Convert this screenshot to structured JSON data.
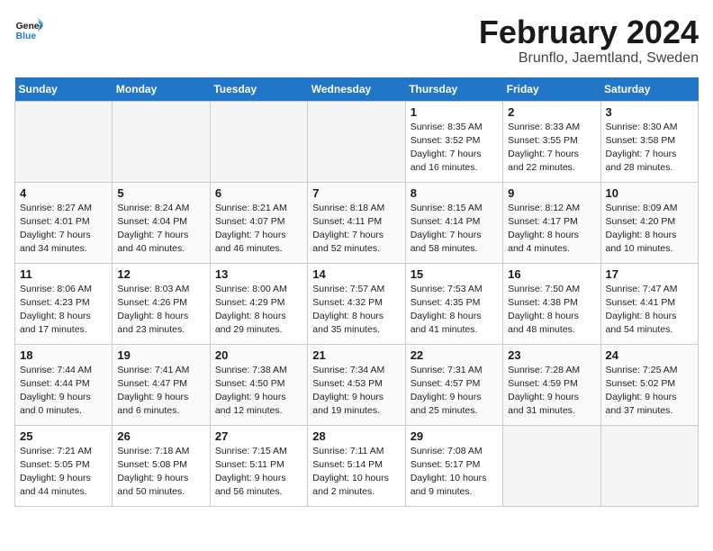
{
  "header": {
    "logo_general": "General",
    "logo_blue": "Blue",
    "month_title": "February 2024",
    "location": "Brunflo, Jaemtland, Sweden"
  },
  "days_of_week": [
    "Sunday",
    "Monday",
    "Tuesday",
    "Wednesday",
    "Thursday",
    "Friday",
    "Saturday"
  ],
  "weeks": [
    [
      {
        "day": "",
        "info": ""
      },
      {
        "day": "",
        "info": ""
      },
      {
        "day": "",
        "info": ""
      },
      {
        "day": "",
        "info": ""
      },
      {
        "day": "1",
        "info": "Sunrise: 8:35 AM\nSunset: 3:52 PM\nDaylight: 7 hours\nand 16 minutes."
      },
      {
        "day": "2",
        "info": "Sunrise: 8:33 AM\nSunset: 3:55 PM\nDaylight: 7 hours\nand 22 minutes."
      },
      {
        "day": "3",
        "info": "Sunrise: 8:30 AM\nSunset: 3:58 PM\nDaylight: 7 hours\nand 28 minutes."
      }
    ],
    [
      {
        "day": "4",
        "info": "Sunrise: 8:27 AM\nSunset: 4:01 PM\nDaylight: 7 hours\nand 34 minutes."
      },
      {
        "day": "5",
        "info": "Sunrise: 8:24 AM\nSunset: 4:04 PM\nDaylight: 7 hours\nand 40 minutes."
      },
      {
        "day": "6",
        "info": "Sunrise: 8:21 AM\nSunset: 4:07 PM\nDaylight: 7 hours\nand 46 minutes."
      },
      {
        "day": "7",
        "info": "Sunrise: 8:18 AM\nSunset: 4:11 PM\nDaylight: 7 hours\nand 52 minutes."
      },
      {
        "day": "8",
        "info": "Sunrise: 8:15 AM\nSunset: 4:14 PM\nDaylight: 7 hours\nand 58 minutes."
      },
      {
        "day": "9",
        "info": "Sunrise: 8:12 AM\nSunset: 4:17 PM\nDaylight: 8 hours\nand 4 minutes."
      },
      {
        "day": "10",
        "info": "Sunrise: 8:09 AM\nSunset: 4:20 PM\nDaylight: 8 hours\nand 10 minutes."
      }
    ],
    [
      {
        "day": "11",
        "info": "Sunrise: 8:06 AM\nSunset: 4:23 PM\nDaylight: 8 hours\nand 17 minutes."
      },
      {
        "day": "12",
        "info": "Sunrise: 8:03 AM\nSunset: 4:26 PM\nDaylight: 8 hours\nand 23 minutes."
      },
      {
        "day": "13",
        "info": "Sunrise: 8:00 AM\nSunset: 4:29 PM\nDaylight: 8 hours\nand 29 minutes."
      },
      {
        "day": "14",
        "info": "Sunrise: 7:57 AM\nSunset: 4:32 PM\nDaylight: 8 hours\nand 35 minutes."
      },
      {
        "day": "15",
        "info": "Sunrise: 7:53 AM\nSunset: 4:35 PM\nDaylight: 8 hours\nand 41 minutes."
      },
      {
        "day": "16",
        "info": "Sunrise: 7:50 AM\nSunset: 4:38 PM\nDaylight: 8 hours\nand 48 minutes."
      },
      {
        "day": "17",
        "info": "Sunrise: 7:47 AM\nSunset: 4:41 PM\nDaylight: 8 hours\nand 54 minutes."
      }
    ],
    [
      {
        "day": "18",
        "info": "Sunrise: 7:44 AM\nSunset: 4:44 PM\nDaylight: 9 hours\nand 0 minutes."
      },
      {
        "day": "19",
        "info": "Sunrise: 7:41 AM\nSunset: 4:47 PM\nDaylight: 9 hours\nand 6 minutes."
      },
      {
        "day": "20",
        "info": "Sunrise: 7:38 AM\nSunset: 4:50 PM\nDaylight: 9 hours\nand 12 minutes."
      },
      {
        "day": "21",
        "info": "Sunrise: 7:34 AM\nSunset: 4:53 PM\nDaylight: 9 hours\nand 19 minutes."
      },
      {
        "day": "22",
        "info": "Sunrise: 7:31 AM\nSunset: 4:57 PM\nDaylight: 9 hours\nand 25 minutes."
      },
      {
        "day": "23",
        "info": "Sunrise: 7:28 AM\nSunset: 4:59 PM\nDaylight: 9 hours\nand 31 minutes."
      },
      {
        "day": "24",
        "info": "Sunrise: 7:25 AM\nSunset: 5:02 PM\nDaylight: 9 hours\nand 37 minutes."
      }
    ],
    [
      {
        "day": "25",
        "info": "Sunrise: 7:21 AM\nSunset: 5:05 PM\nDaylight: 9 hours\nand 44 minutes."
      },
      {
        "day": "26",
        "info": "Sunrise: 7:18 AM\nSunset: 5:08 PM\nDaylight: 9 hours\nand 50 minutes."
      },
      {
        "day": "27",
        "info": "Sunrise: 7:15 AM\nSunset: 5:11 PM\nDaylight: 9 hours\nand 56 minutes."
      },
      {
        "day": "28",
        "info": "Sunrise: 7:11 AM\nSunset: 5:14 PM\nDaylight: 10 hours\nand 2 minutes."
      },
      {
        "day": "29",
        "info": "Sunrise: 7:08 AM\nSunset: 5:17 PM\nDaylight: 10 hours\nand 9 minutes."
      },
      {
        "day": "",
        "info": ""
      },
      {
        "day": "",
        "info": ""
      }
    ]
  ]
}
